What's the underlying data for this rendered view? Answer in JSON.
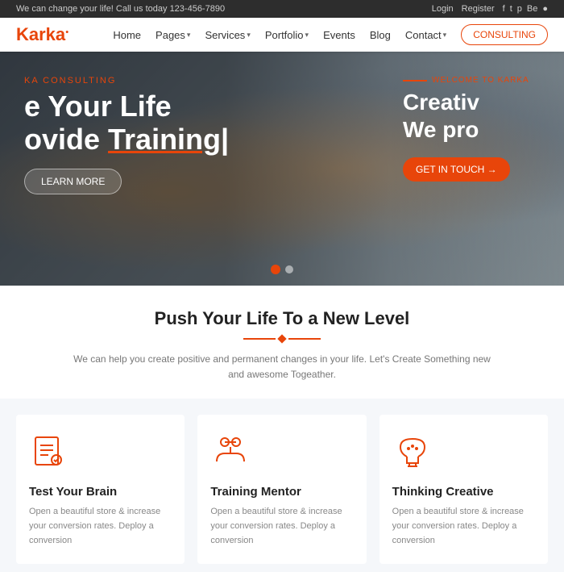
{
  "topbar": {
    "tagline": "We can change your life! Call us today  123-456-7890",
    "login": "Login",
    "register": "Register",
    "social": [
      "f",
      "t",
      "p",
      "Be",
      "●"
    ]
  },
  "header": {
    "logo_main": "Karka",
    "logo_dot": "●",
    "nav_items": [
      {
        "label": "Home",
        "has_dropdown": false
      },
      {
        "label": "Pages",
        "has_dropdown": true
      },
      {
        "label": "Services",
        "has_dropdown": true
      },
      {
        "label": "Portfolio",
        "has_dropdown": true
      },
      {
        "label": "Events",
        "has_dropdown": false
      },
      {
        "label": "Blog",
        "has_dropdown": false
      },
      {
        "label": "Contact",
        "has_dropdown": true
      }
    ],
    "consulting_btn": "CONSULTING"
  },
  "hero": {
    "tag": "KA CONSULTING",
    "title_line1": "e Your Life",
    "title_line2": "ovide Training|",
    "underline_word": "Training|",
    "learn_more": "LEARN MORE",
    "right_welcome": "WELCOME TO KARKA",
    "right_title_line1": "Creativ",
    "right_title_line2": "We pro",
    "get_in_touch": "GET IN TOUCH →"
  },
  "slider": {
    "dots": [
      true,
      false
    ]
  },
  "intro": {
    "title": "Push Your Life To a New Level",
    "description": "We can help you create positive and permanent changes in your life. Let's\nCreate Something new and awesome Togeather."
  },
  "cards": [
    {
      "id": "test-brain",
      "title": "Test Your Brain",
      "description": "Open a beautiful store & increase your conversion rates. Deploy a conversion"
    },
    {
      "id": "training-mentor",
      "title": "Training Mentor",
      "description": "Open a beautiful store & increase your conversion rates. Deploy a conversion"
    },
    {
      "id": "thinking-creative",
      "title": "Thinking Creative",
      "description": "Open a beautiful store & increase your conversion rates. Deploy a conversion"
    }
  ],
  "colors": {
    "accent": "#e8450a",
    "dark": "#2d2d2d",
    "text": "#333",
    "muted": "#888"
  }
}
